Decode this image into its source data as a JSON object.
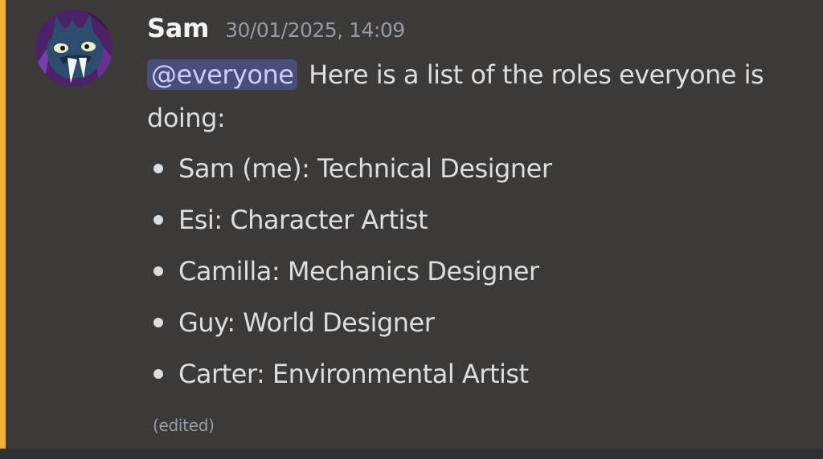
{
  "message": {
    "author": "Sam",
    "timestamp": "30/01/2025, 14:09",
    "mention": "@everyone",
    "intro_text": "Here is a list of the roles everyone is doing:",
    "roles": [
      {
        "text": "Sam (me): Technical Designer"
      },
      {
        "text": "Esi: Character Artist"
      },
      {
        "text": "Camilla: Mechanics Designer"
      },
      {
        "text": "Guy: World Designer"
      },
      {
        "text": "Carter: Environmental Artist"
      }
    ],
    "edited_label": "(edited)"
  },
  "colors": {
    "background": "#3b3a38",
    "accent_bar": "#f0b232",
    "mention_bg": "#4a4c7a",
    "mention_text": "#c9cdfb",
    "text": "#dbdee1",
    "muted": "#949ba4"
  },
  "icons": {
    "avatar": "monster-avatar-icon"
  }
}
